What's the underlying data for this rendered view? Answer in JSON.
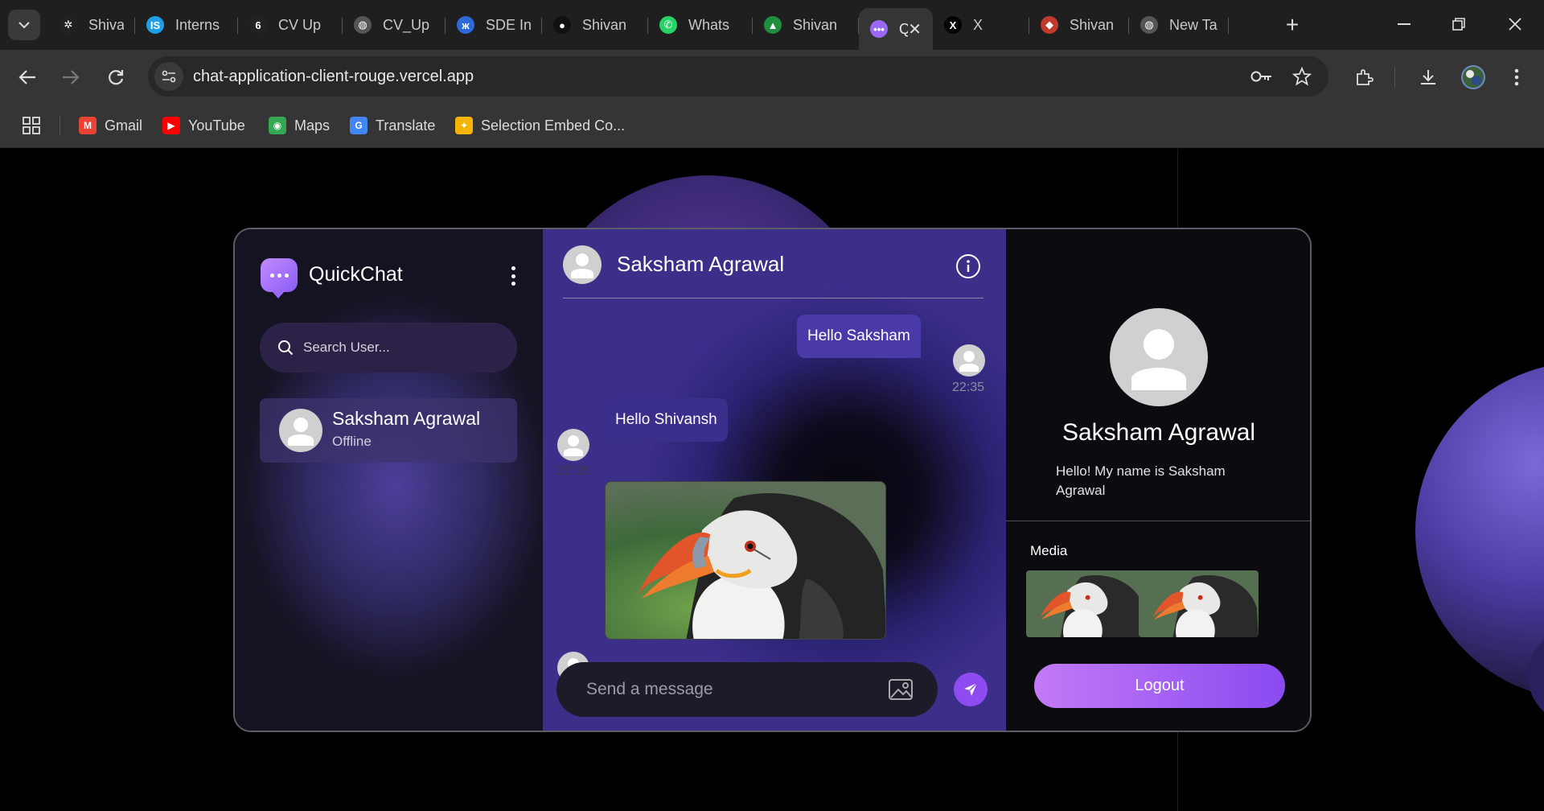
{
  "browser": {
    "tabs": [
      {
        "title": "Shivan",
        "icon": "openai-icon",
        "color": "#222222"
      },
      {
        "title": "Interns",
        "icon": "internshala-icon",
        "color": "#1ea0e6"
      },
      {
        "title": "CV Up",
        "icon": "cv-icon",
        "color": "#222222"
      },
      {
        "title": "CV_Up",
        "icon": "globe-icon",
        "color": "#555555"
      },
      {
        "title": "SDE Int",
        "icon": "butterfly-icon",
        "color": "#2b6ad8"
      },
      {
        "title": "Shivan",
        "icon": "github-icon",
        "color": "#111111"
      },
      {
        "title": "Whats",
        "icon": "whatsapp-icon",
        "color": "#25d366"
      },
      {
        "title": "Shivan",
        "icon": "drive-icon",
        "color": "#1f8e3d"
      },
      {
        "title": "Qu",
        "icon": "quickchat-icon",
        "color": "#9a68f7",
        "active": true
      },
      {
        "title": "X",
        "icon": "x-icon",
        "color": "#000000"
      },
      {
        "title": "Shivan",
        "icon": "bag-icon",
        "color": "#c0392b"
      },
      {
        "title": "New Ta",
        "icon": "globe-icon",
        "color": "#555555"
      }
    ],
    "url": "chat-application-client-rouge.vercel.app",
    "bookmarks": [
      {
        "label": "Gmail",
        "color": "#ea4335"
      },
      {
        "label": "YouTube",
        "color": "#ff0000"
      },
      {
        "label": "Maps",
        "color": "#34a853"
      },
      {
        "label": "Translate",
        "color": "#4285f4"
      },
      {
        "label": "Selection Embed Co...",
        "color": "#f4b400"
      }
    ]
  },
  "app": {
    "name": "QuickChat",
    "search_placeholder": "Search User...",
    "contacts": [
      {
        "name": "Saksham Agrawal",
        "status": "Offline"
      }
    ],
    "chat": {
      "title": "Saksham Agrawal",
      "messages": [
        {
          "text": "Hello Saksham",
          "time": "22:35",
          "direction": "sent"
        },
        {
          "text": "Hello Shivansh",
          "time": "22:35",
          "direction": "received"
        }
      ],
      "input_placeholder": "Send a message"
    },
    "profile": {
      "name": "Saksham Agrawal",
      "bio": "Hello! My name is Saksham Agrawal",
      "media_title": "Media",
      "logout_label": "Logout"
    }
  }
}
